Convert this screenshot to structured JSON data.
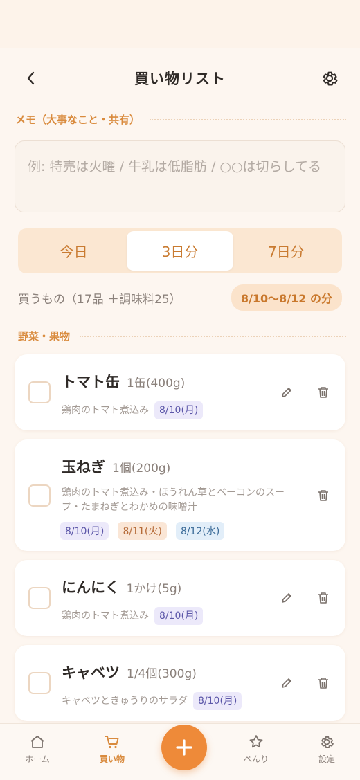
{
  "header": {
    "title": "買い物リスト"
  },
  "memo": {
    "section_label": "メモ（大事なこと・共有）",
    "placeholder": "例: 特売は火曜 / 牛乳は低脂肪 / ○○は切らしてる"
  },
  "segments": [
    {
      "label": "今日",
      "active": false
    },
    {
      "label": "3日分",
      "active": true
    },
    {
      "label": "7日分",
      "active": false
    }
  ],
  "summary": {
    "text": "買うもの（17品 ＋調味料25）",
    "range": "8/10〜8/12 の分"
  },
  "category": {
    "label": "野菜・果物"
  },
  "items": [
    {
      "name": "トマト缶",
      "qty": "1缶(400g)",
      "recipe": "鶏肉のトマト煮込み",
      "tags": [
        {
          "label": "8/10(月)",
          "color": "#ece9fa"
        }
      ]
    },
    {
      "name": "玉ねぎ",
      "qty": "1個(200g)",
      "recipe_line1": "鶏肉のトマト煮込み・ほうれん草とベーコンのスー",
      "recipe_line2": "プ・たまねぎとわかめの味噌汁",
      "tags": [
        {
          "label": "8/10(月)",
          "color": "#ece9fa"
        },
        {
          "label": "8/11(火)",
          "color": "#fae6d6"
        },
        {
          "label": "8/12(水)",
          "color": "#e2eef9"
        }
      ]
    },
    {
      "name": "にんにく",
      "qty": "1かけ(5g)",
      "recipe": "鶏肉のトマト煮込み",
      "tags": [
        {
          "label": "8/10(月)",
          "color": "#ece9fa"
        }
      ]
    },
    {
      "name": "キャベツ",
      "qty": "1/4個(300g)",
      "recipe": "キャベツときゅうりのサラダ",
      "tags": [
        {
          "label": "8/10(月)",
          "color": "#ece9fa"
        }
      ]
    }
  ],
  "nav": {
    "home": "ホーム",
    "shopping": "買い物",
    "fab": "+",
    "benri": "べんり",
    "settings": "設定"
  },
  "colors": {
    "accent": "#ee8a39",
    "section": "#d98b3e"
  }
}
